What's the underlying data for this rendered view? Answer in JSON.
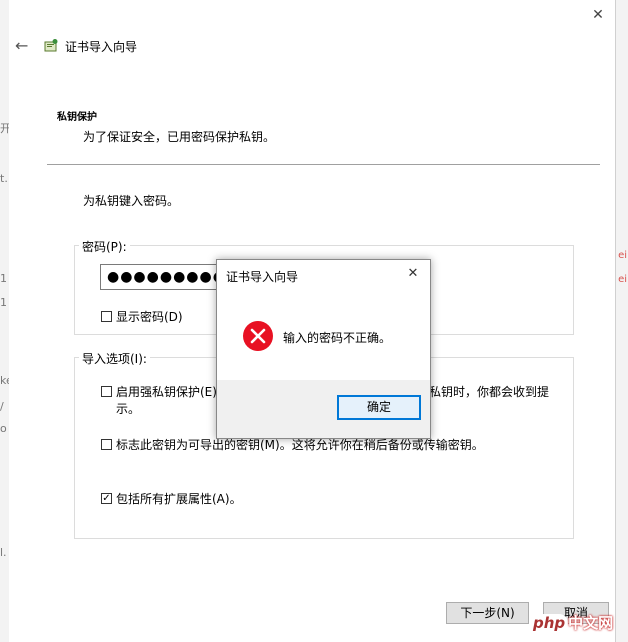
{
  "background": {
    "left_fragments": [
      "开",
      "t.",
      "1",
      "1",
      "ke",
      "/",
      "o",
      "l."
    ],
    "right_fragments": [
      "ei",
      "ei"
    ]
  },
  "wizard": {
    "title": "证书导入向导",
    "section_heading": "私钥保护",
    "section_subtitle": "为了保证安全，已用密码保护私钥。",
    "prompt": "为私钥键入密码。",
    "password_label": "密码(P):",
    "password_value": "●●●●●●●●●●",
    "show_password_label": "显示密码(D)",
    "import_options_label": "导入选项(I):",
    "option_strong_protection": "启用强私钥保护(E)",
    "option_strong_protection_tail": "私钥时，你都会收到提",
    "option_strong_protection_wrap": "示。",
    "option_exportable": "标志此密钥为可导出的密钥(M)。这将允许你在稍后备份或传输密钥。",
    "option_extended_props": "包括所有扩展属性(A)。",
    "option_extended_props_checked": true,
    "next_button": "下一步(N)",
    "cancel_button": "取消"
  },
  "dialog": {
    "title": "证书导入向导",
    "message": "输入的密码不正确。",
    "ok_button": "确定",
    "icon": "error-icon"
  },
  "watermark": {
    "brand": "php",
    "suffix": "中文网"
  },
  "colors": {
    "accent": "#0078d7",
    "error_red": "#e81123"
  }
}
